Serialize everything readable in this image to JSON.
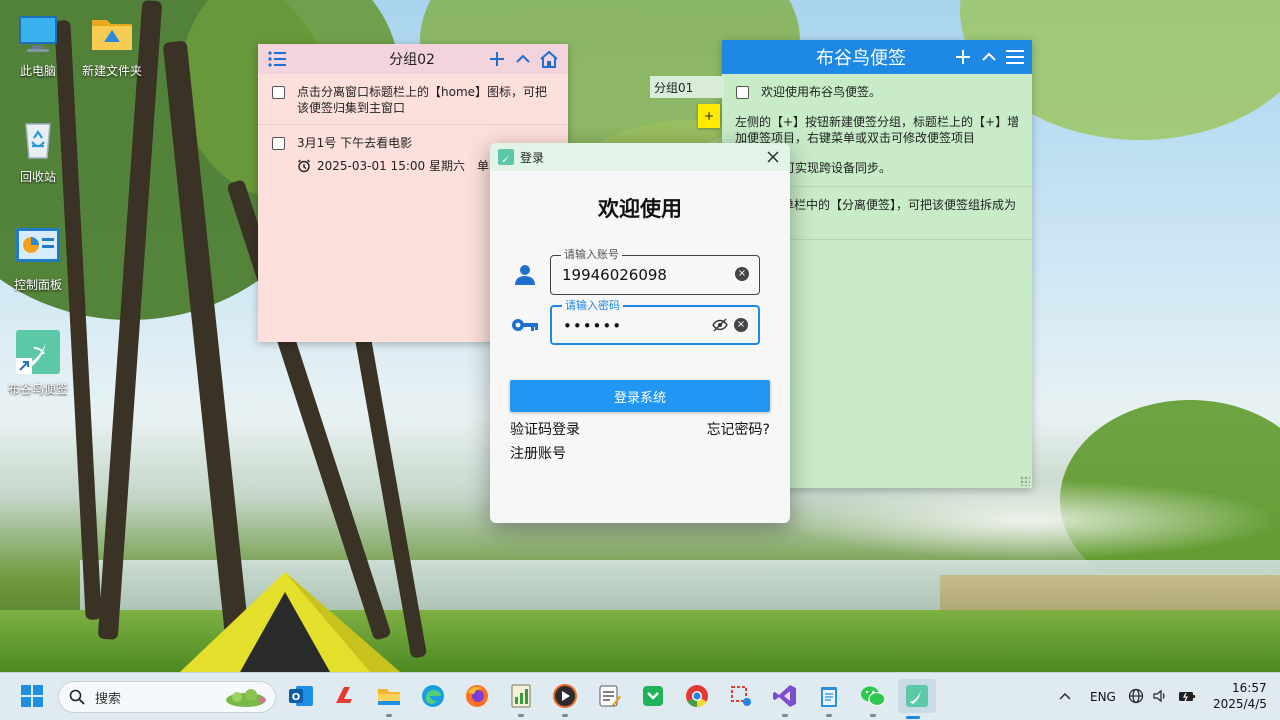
{
  "desktop": {
    "icons": [
      {
        "label": "此电脑",
        "icon": "computer-icon"
      },
      {
        "label": "新建文件夹",
        "icon": "folder-icon"
      },
      {
        "label": "回收站",
        "icon": "recycle-bin-icon"
      },
      {
        "label": "控制面板",
        "icon": "control-panel-icon"
      },
      {
        "label": "布谷鸟便签",
        "icon": "cuckoo-notes-icon"
      }
    ]
  },
  "group02_window": {
    "title": "分组02",
    "items": [
      {
        "text": "点击分离窗口标题栏上的【home】图标，可把该便签归集到主窗口"
      },
      {
        "text": "3月1号 下午去看电影",
        "reminder": "2025-03-01 15:00 星期六",
        "extra": "单"
      }
    ]
  },
  "main_window": {
    "title": "布谷鸟便签",
    "group_tab": "分组01",
    "add_label": "+",
    "items": [
      {
        "lines": [
          "欢迎使用布谷鸟便签。",
          "左侧的【+】按钮新建便签分组，标题栏上的【+】增加便签项目，右键菜单或双击可修改便签项目",
          "注册后，可实现跨设备同步。"
        ]
      },
      {
        "lines": [
          "主窗口菜单栏中的【分离便签】，可把该便签组拆成为独立窗口"
        ]
      }
    ]
  },
  "login_dialog": {
    "title": "登录",
    "heading": "欢迎使用",
    "account": {
      "label": "请输入账号",
      "value": "19946026098"
    },
    "password": {
      "label": "请输入密码",
      "value": "••••••"
    },
    "submit_label": "登录系统",
    "sms_login": "验证码登录",
    "forgot": "忘记密码?",
    "register": "注册账号",
    "accent": "#2196f3"
  },
  "taskbar": {
    "search_placeholder": "搜索",
    "language": "ENG",
    "time": "16:57",
    "date": "2025/4/5",
    "apps": [
      "outlook-icon",
      "wps-icon",
      "file-explorer-icon",
      "edge-icon",
      "firefox-icon",
      "spreadsheet-icon",
      "media-player-icon",
      "notes-icon",
      "green-app-icon",
      "chrome-icon",
      "snip-tool-icon",
      "visual-studio-icon",
      "notepad-icon",
      "wechat-icon",
      "cuckoo-notes-icon"
    ]
  }
}
